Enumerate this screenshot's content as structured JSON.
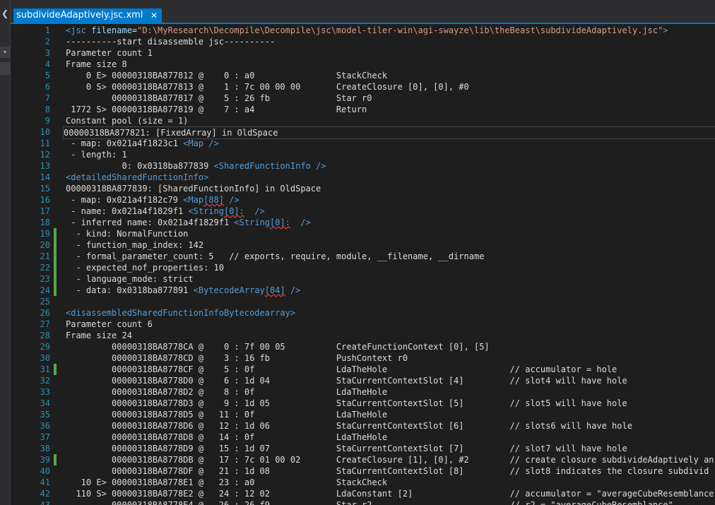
{
  "tab": {
    "title": "subdivideAdaptively.jsc.xml",
    "close": "✕"
  },
  "side": {
    "chevron": "❮",
    "dropdown": "▾"
  },
  "lines": [
    {
      "n": "1",
      "parts": [
        [
          "tag",
          "<jsc "
        ],
        [
          "attr",
          "filename"
        ],
        [
          "txt",
          "="
        ],
        [
          "str",
          "\"D:\\MyResearch\\Decompile\\Decompile\\jsc\\model-tiler-win\\agi-swayze\\lib\\theBeast\\subdivideAdaptively.jsc\""
        ],
        [
          "tag",
          ">"
        ]
      ]
    },
    {
      "n": "2",
      "parts": [
        [
          "txt",
          "----------start disassemble jsc----------"
        ]
      ]
    },
    {
      "n": "3",
      "parts": [
        [
          "txt",
          "Parameter count 1"
        ]
      ]
    },
    {
      "n": "4",
      "parts": [
        [
          "txt",
          "Frame size 8"
        ]
      ]
    },
    {
      "n": "5",
      "parts": [
        [
          "txt",
          "    0 E> 00000318BA877812 @    0 : a0                StackCheck"
        ]
      ]
    },
    {
      "n": "6",
      "parts": [
        [
          "txt",
          "    0 S> 00000318BA877813 @    1 : 7c 00 00 00       CreateClosure [0], [0], #0"
        ]
      ]
    },
    {
      "n": "7",
      "parts": [
        [
          "txt",
          "         00000318BA877817 @    5 : 26 fb             Star r0"
        ]
      ]
    },
    {
      "n": "8",
      "parts": [
        [
          "txt",
          " 1772 S> 00000318BA877819 @    7 : a4                Return"
        ]
      ]
    },
    {
      "n": "9",
      "parts": [
        [
          "txt",
          "Constant pool (size = 1)"
        ]
      ]
    },
    {
      "n": "10",
      "current": true,
      "parts": [
        [
          "txt",
          "00000318BA877821: [FixedArray] in OldSpace"
        ]
      ]
    },
    {
      "n": "11",
      "parts": [
        [
          "txt",
          " - map: 0x021a4f1823c1 "
        ],
        [
          "tag",
          "<Map />"
        ]
      ]
    },
    {
      "n": "12",
      "parts": [
        [
          "txt",
          " - length: 1"
        ]
      ]
    },
    {
      "n": "13",
      "parts": [
        [
          "txt",
          "           0: 0x0318ba877839 "
        ],
        [
          "tag",
          "<SharedFunctionInfo />"
        ]
      ]
    },
    {
      "n": "14",
      "parts": [
        [
          "tag",
          "<detailedSharedFunctionInfo>"
        ]
      ]
    },
    {
      "n": "15",
      "parts": [
        [
          "txt",
          "00000318BA877839: [SharedFunctionInfo] in OldSpace"
        ]
      ]
    },
    {
      "n": "16",
      "parts": [
        [
          "txt",
          " - map: 0x021a4f182c79 "
        ],
        [
          "tag",
          "<Map"
        ],
        [
          "sqtag",
          "[88]"
        ],
        [
          "tag",
          " />"
        ]
      ]
    },
    {
      "n": "17",
      "parts": [
        [
          "txt",
          " - name: 0x021a4f1829f1 "
        ],
        [
          "tag",
          "<String"
        ],
        [
          "sqtag",
          "[0]:"
        ],
        [
          "tag",
          "  />"
        ]
      ]
    },
    {
      "n": "18",
      "parts": [
        [
          "txt",
          " - inferred name: 0x021a4f1829f1 "
        ],
        [
          "tag",
          "<String"
        ],
        [
          "sqtag",
          "[0]:"
        ],
        [
          "tag",
          "  />"
        ]
      ]
    },
    {
      "n": "19",
      "changed": true,
      "parts": [
        [
          "txt",
          "  - kind: NormalFunction"
        ]
      ]
    },
    {
      "n": "20",
      "changed": true,
      "parts": [
        [
          "txt",
          "  - function_map_index: 142"
        ]
      ]
    },
    {
      "n": "21",
      "changed": true,
      "parts": [
        [
          "txt",
          "  - formal_parameter_count: 5   // exports, require, module, __filename, __dirname"
        ]
      ]
    },
    {
      "n": "22",
      "changed": true,
      "parts": [
        [
          "txt",
          "  - expected_nof_properties: 10"
        ]
      ]
    },
    {
      "n": "23",
      "changed": true,
      "parts": [
        [
          "txt",
          "  - language_mode: strict"
        ]
      ]
    },
    {
      "n": "24",
      "changed": true,
      "parts": [
        [
          "txt",
          "  - data: 0x0318ba877891 "
        ],
        [
          "tag",
          "<BytecodeArray"
        ],
        [
          "sqtag",
          "[84]"
        ],
        [
          "tag",
          " />"
        ]
      ]
    },
    {
      "n": "25",
      "parts": [
        [
          "txt",
          ""
        ]
      ]
    },
    {
      "n": "26",
      "parts": [
        [
          "tag",
          "<disassembledSharedFunctionInfoBytecodearray>"
        ]
      ]
    },
    {
      "n": "27",
      "parts": [
        [
          "txt",
          "Parameter count 6"
        ]
      ]
    },
    {
      "n": "28",
      "parts": [
        [
          "txt",
          "Frame size 24"
        ]
      ]
    },
    {
      "n": "29",
      "parts": [
        [
          "txt",
          "         00000318BA8778CA @    0 : 7f 00 05          CreateFunctionContext [0], [5]"
        ]
      ]
    },
    {
      "n": "30",
      "parts": [
        [
          "txt",
          "         00000318BA8778CD @    3 : 16 fb             PushContext r0"
        ]
      ]
    },
    {
      "n": "31",
      "changed": true,
      "parts": [
        [
          "txt",
          "         00000318BA8778CF @    5 : 0f                LdaTheHole                        // accumulator = hole"
        ]
      ]
    },
    {
      "n": "32",
      "parts": [
        [
          "txt",
          "         00000318BA8778D0 @    6 : 1d 04             StaCurrentContextSlot [4]         // slot4 will have hole"
        ]
      ]
    },
    {
      "n": "33",
      "parts": [
        [
          "txt",
          "         00000318BA8778D2 @    8 : 0f                LdaTheHole"
        ]
      ]
    },
    {
      "n": "34",
      "parts": [
        [
          "txt",
          "         00000318BA8778D3 @    9 : 1d 05             StaCurrentContextSlot [5]         // slot5 will have hole"
        ]
      ]
    },
    {
      "n": "35",
      "parts": [
        [
          "txt",
          "         00000318BA8778D5 @   11 : 0f                LdaTheHole"
        ]
      ]
    },
    {
      "n": "36",
      "parts": [
        [
          "txt",
          "         00000318BA8778D6 @   12 : 1d 06             StaCurrentContextSlot [6]         // slots6 will have hole"
        ]
      ]
    },
    {
      "n": "37",
      "parts": [
        [
          "txt",
          "         00000318BA8778D8 @   14 : 0f                LdaTheHole"
        ]
      ]
    },
    {
      "n": "38",
      "parts": [
        [
          "txt",
          "         00000318BA8778D9 @   15 : 1d 07             StaCurrentContextSlot [7]         // slot7 will have hole"
        ]
      ]
    },
    {
      "n": "39",
      "changed": true,
      "parts": [
        [
          "txt",
          "         00000318BA8778DB @   17 : 7c 01 00 02       CreateClosure [1], [0], #2        // create closure subdivideAdaptively an"
        ]
      ]
    },
    {
      "n": "40",
      "parts": [
        [
          "txt",
          "         00000318BA8778DF @   21 : 1d 08             StaCurrentContextSlot [8]         // slot8 indicates the closure subdivid"
        ]
      ]
    },
    {
      "n": "41",
      "parts": [
        [
          "txt",
          "   10 E> 00000318BA8778E1 @   23 : a0                StackCheck"
        ]
      ]
    },
    {
      "n": "42",
      "parts": [
        [
          "txt",
          "  110 S> 00000318BA8778E2 @   24 : 12 02             LdaConstant [2]                   // accumulator = \"averageCubeResemblance"
        ]
      ]
    },
    {
      "n": "43",
      "parts": [
        [
          "txt",
          "         00000318BA8778E4 @   26 : 26 f9             Star r2                           // r2 = \"averageCubeResemblance\""
        ]
      ]
    }
  ]
}
